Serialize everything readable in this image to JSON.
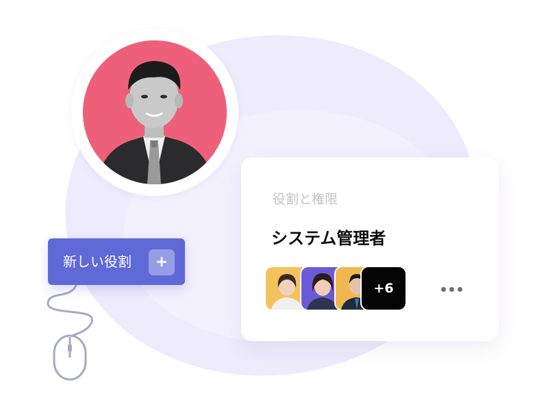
{
  "role_card": {
    "caption": "役割と権限",
    "title": "システム管理者",
    "extra_members": "+6",
    "more_icon": "more-horizontal-icon"
  },
  "new_role_button": {
    "label": "新しい役割",
    "plus_symbol": "+"
  },
  "colors": {
    "blob": "#eeebfd",
    "profile_background": "#ee6079",
    "button": "#5f69d8",
    "mouse_outline": "#a7a8c5"
  }
}
